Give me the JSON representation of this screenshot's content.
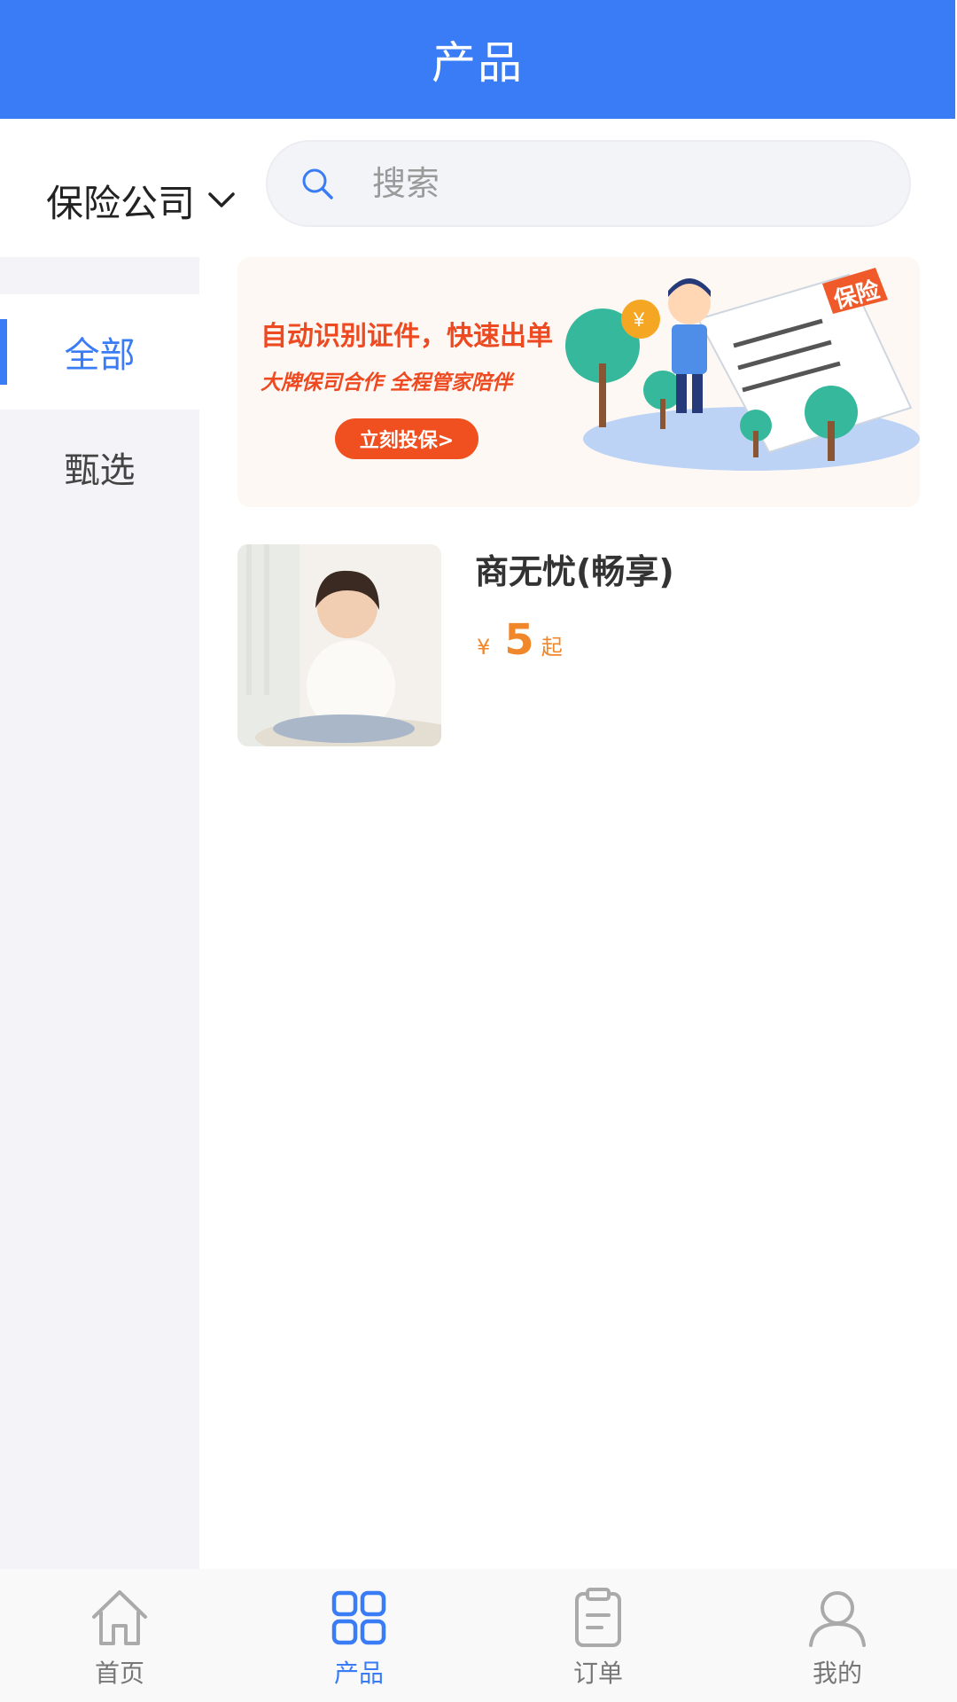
{
  "header": {
    "title": "产品"
  },
  "filter": {
    "company_label": "保险公司",
    "search_placeholder": "搜索"
  },
  "sidebar": {
    "items": [
      {
        "label": "全部",
        "active": true
      },
      {
        "label": "甄选",
        "active": false
      }
    ]
  },
  "banner": {
    "headline": "自动识别证件，快速出单",
    "subline": "大牌保司合作  全程管家陪伴",
    "cta": "立刻投保>",
    "badge": "保险"
  },
  "products": [
    {
      "name": "商无忧(畅享)",
      "currency": "¥",
      "price": "5",
      "price_suffix": "起"
    }
  ],
  "tabbar": {
    "items": [
      {
        "label": "首页",
        "icon": "home-icon",
        "active": false
      },
      {
        "label": "产品",
        "icon": "grid-icon",
        "active": true
      },
      {
        "label": "订单",
        "icon": "clipboard-icon",
        "active": false
      },
      {
        "label": "我的",
        "icon": "user-icon",
        "active": false
      }
    ]
  },
  "colors": {
    "primary": "#3a7cf5",
    "price": "#f0882b",
    "banner_red": "#ee4a21",
    "sidebar_bg": "#f4f4f8"
  }
}
